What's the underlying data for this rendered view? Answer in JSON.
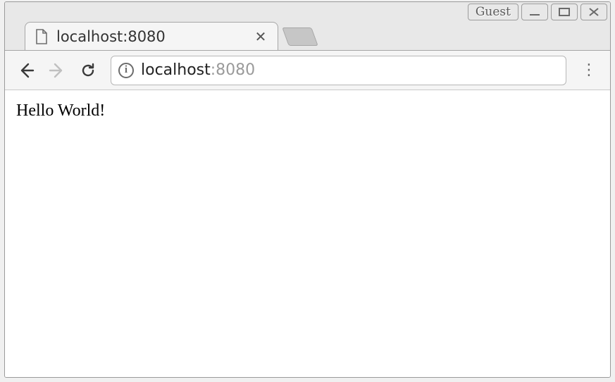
{
  "window": {
    "guest_label": "Guest"
  },
  "tab": {
    "title": "localhost:8080"
  },
  "omnibox": {
    "host": "localhost",
    "port_suffix": ":8080"
  },
  "page": {
    "body": "Hello World!"
  }
}
